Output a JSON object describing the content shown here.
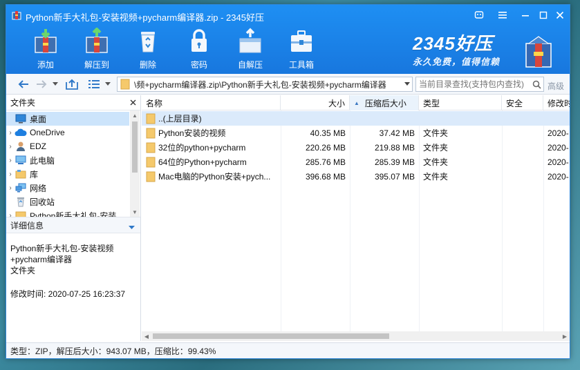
{
  "window": {
    "title": "Python新手大礼包-安装视频+pycharm编译器.zip - 2345好压"
  },
  "toolbar": {
    "items": [
      {
        "label": "添加",
        "icon": "add-archive-icon"
      },
      {
        "label": "解压到",
        "icon": "extract-to-icon"
      },
      {
        "label": "删除",
        "icon": "recycle-bin-icon"
      },
      {
        "label": "密码",
        "icon": "lock-icon"
      },
      {
        "label": "自解压",
        "icon": "self-extract-icon"
      },
      {
        "label": "工具箱",
        "icon": "toolbox-icon"
      }
    ]
  },
  "brand": {
    "main": "2345好压",
    "slogan": "永久免费，值得信赖"
  },
  "navbar": {
    "address": "\\频+pycharm编译器.zip\\Python新手大礼包-安装视频+pycharm编译器",
    "search_placeholder": "当前目录查找(支持包内查找)",
    "advanced": "高级"
  },
  "folders_panel": {
    "title": "文件夹",
    "items": [
      {
        "label": "桌面",
        "icon": "desktop-icon",
        "arrow": "",
        "selected": true
      },
      {
        "label": "OneDrive",
        "icon": "onedrive-cloud-icon",
        "arrow": "›"
      },
      {
        "label": "EDZ",
        "icon": "user-icon",
        "arrow": "›"
      },
      {
        "label": "此电脑",
        "icon": "computer-icon",
        "arrow": "›"
      },
      {
        "label": "库",
        "icon": "library-icon",
        "arrow": "›"
      },
      {
        "label": "网络",
        "icon": "network-icon",
        "arrow": "›"
      },
      {
        "label": "回收站",
        "icon": "recycle-bin-icon",
        "arrow": ""
      },
      {
        "label": "Python新手大礼包-安装",
        "icon": "folder-icon",
        "arrow": "›"
      }
    ]
  },
  "details_panel": {
    "title": "详细信息",
    "name_line1": "Python新手大礼包-安装视频",
    "name_line2": "+pycharm编译器",
    "type": "文件夹",
    "modified": "修改时间:  2020-07-25 16:23:37"
  },
  "file_list": {
    "columns": [
      "名称",
      "大小",
      "压缩后大小",
      "类型",
      "安全",
      "修改时间"
    ],
    "rows": [
      {
        "name": "..(上层目录)",
        "size": "",
        "packed": "",
        "type": "",
        "security": "",
        "modified": ""
      },
      {
        "name": "Python安装的视频",
        "size": "40.35 MB",
        "packed": "37.42 MB",
        "type": "文件夹",
        "security": "",
        "modified": "2020-"
      },
      {
        "name": "32位的python+pycharm",
        "size": "220.26 MB",
        "packed": "219.88 MB",
        "type": "文件夹",
        "security": "",
        "modified": "2020-"
      },
      {
        "name": "64位的Python+pycharm",
        "size": "285.76 MB",
        "packed": "285.39 MB",
        "type": "文件夹",
        "security": "",
        "modified": "2020-"
      },
      {
        "name": "Mac电脑的Python安装+pych...",
        "size": "396.68 MB",
        "packed": "395.07 MB",
        "type": "文件夹",
        "security": "",
        "modified": "2020-"
      }
    ]
  },
  "status": {
    "text": "类型：ZIP，解压后大小：943.07 MB，压缩比：99.43%"
  },
  "colors": {
    "title_bar": "#1e8ff3",
    "selection": "#cce4fb",
    "folder": "#f5c96b"
  }
}
